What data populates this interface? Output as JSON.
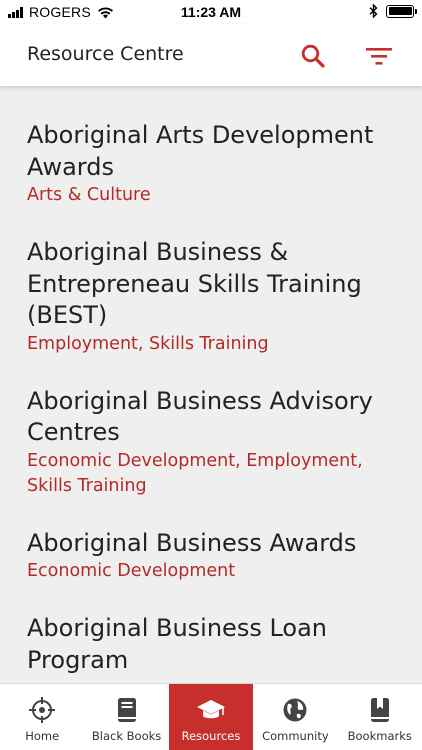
{
  "status_bar": {
    "carrier": "ROGERS",
    "time": "11:23 AM"
  },
  "header": {
    "title": "Resource Centre",
    "search_icon": "search-icon",
    "filter_icon": "filter-icon"
  },
  "colors": {
    "accent": "#c62f2b",
    "tag_text": "#b52a26",
    "background": "#efefef"
  },
  "resources": [
    {
      "title": "Aboriginal Arts Development Awards",
      "tags": "Arts & Culture"
    },
    {
      "title": "Aboriginal Business & Entrepreneau Skills Training (BEST)",
      "tags": "Employment, Skills Training"
    },
    {
      "title": "Aboriginal Business Advisory Centres",
      "tags": "Economic Development, Employment, Skills Training"
    },
    {
      "title": "Aboriginal Business Awards",
      "tags": "Economic Development"
    },
    {
      "title": "Aboriginal Business Loan Program",
      "tags": ""
    }
  ],
  "tabs": [
    {
      "label": "Home",
      "icon": "crosshair-icon",
      "active": false
    },
    {
      "label": "Black Books",
      "icon": "book-icon",
      "active": false
    },
    {
      "label": "Resources",
      "icon": "graduation-cap-icon",
      "active": true
    },
    {
      "label": "Community",
      "icon": "globe-icon",
      "active": false
    },
    {
      "label": "Bookmarks",
      "icon": "bookmark-icon",
      "active": false
    }
  ]
}
